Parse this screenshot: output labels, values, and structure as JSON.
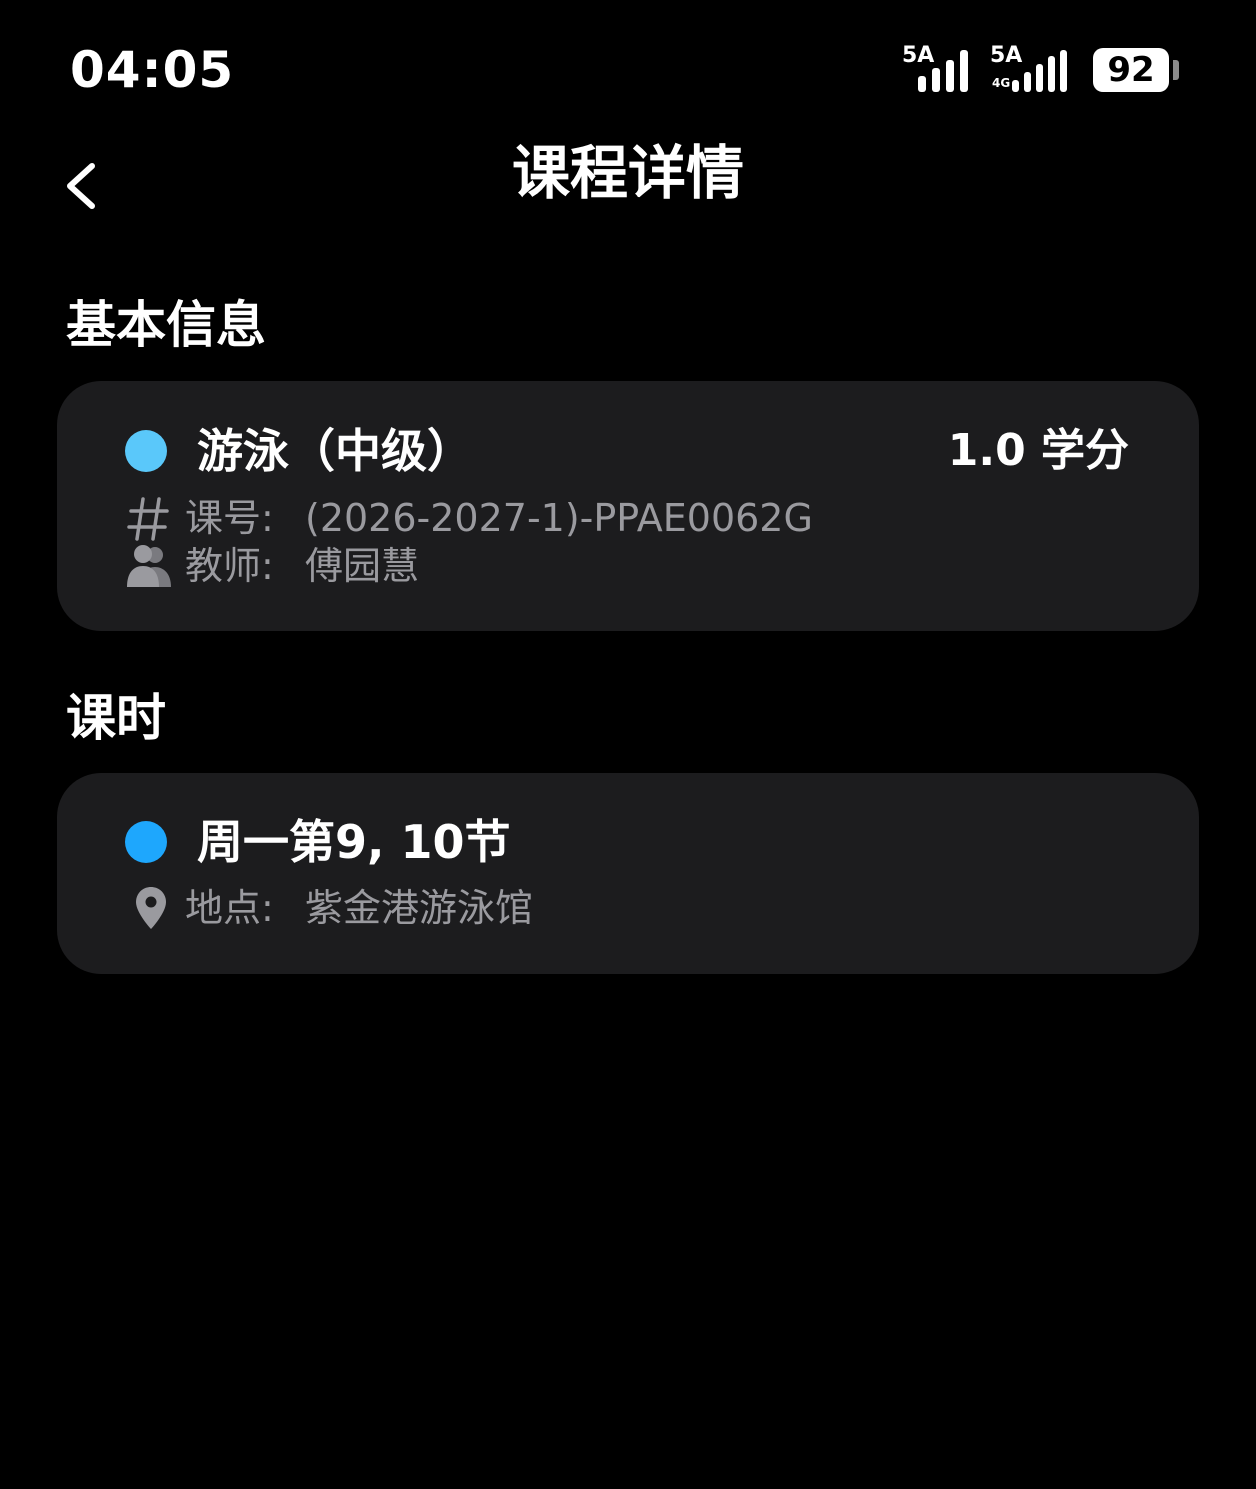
{
  "status_bar": {
    "time": "04:05",
    "signal_1_label": "5A",
    "signal_2_label": "5A",
    "signal_2_sublabel": "4G",
    "battery_level": "92"
  },
  "header": {
    "title": "课程详情",
    "back_icon": "chevron-left-icon"
  },
  "basic_info": {
    "heading": "基本信息",
    "course_name": "游泳（中级）",
    "credits": "1.0 学分",
    "dot_color": "#5ac8fa",
    "course_code_label": "课号:",
    "course_code_value": "(2026-2027-1)-PPAE0062G",
    "course_code_icon": "hash-icon",
    "teacher_label": "教师:",
    "teacher_value": "傅园慧",
    "teacher_icon": "people-icon"
  },
  "schedule": {
    "heading": "课时",
    "time_slot": "周一第9, 10节",
    "dot_color": "#1ea7fd",
    "location_label": "地点:",
    "location_value": "紫金港游泳馆",
    "location_icon": "location-pin-icon"
  },
  "colors": {
    "background": "#000000",
    "card": "#1c1c1e",
    "secondary_text": "#9a9a9f"
  }
}
